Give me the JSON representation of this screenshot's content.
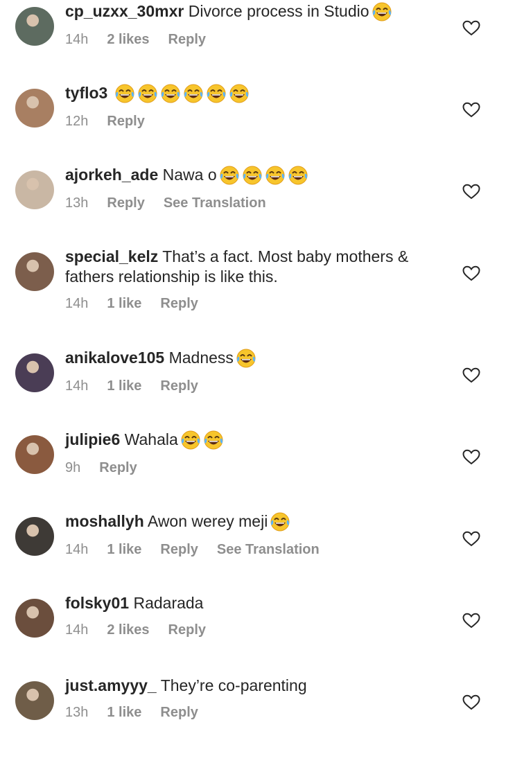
{
  "comments": [
    {
      "username": "cp_uzxx_30mxr",
      "text": "Divorce process in Studio",
      "emojis": [
        "laughing-tears-emoji"
      ],
      "time": "14h",
      "likes": "2 likes",
      "reply": "Reply",
      "translate": "",
      "avatar_color": "#5d6b60"
    },
    {
      "username": "tyflo3",
      "text": "",
      "emojis": [
        "laughing-tears-emoji",
        "laughing-tears-emoji",
        "laughing-tears-emoji",
        "laughing-tears-emoji",
        "laughing-tears-emoji",
        "laughing-tears-emoji"
      ],
      "time": "12h",
      "likes": "",
      "reply": "Reply",
      "translate": "",
      "avatar_color": "#a87f62"
    },
    {
      "username": "ajorkeh_ade",
      "text": "Nawa o",
      "emojis": [
        "laughing-tears-emoji",
        "laughing-tears-emoji",
        "laughing-tears-emoji",
        "laughing-tears-emoji"
      ],
      "time": "13h",
      "likes": "",
      "reply": "Reply",
      "translate": "See Translation",
      "avatar_color": "#c9b7a4"
    },
    {
      "username": "special_kelz",
      "text": "That’s a fact. Most baby mothers & fathers relationship is like this.",
      "emojis": [],
      "time": "14h",
      "likes": "1 like",
      "reply": "Reply",
      "translate": "",
      "avatar_color": "#7c5e4c"
    },
    {
      "username": "anikalove105",
      "text": "Madness",
      "emojis": [
        "laughing-tears-emoji"
      ],
      "time": "14h",
      "likes": "1 like",
      "reply": "Reply",
      "translate": "",
      "avatar_color": "#4a3d55"
    },
    {
      "username": "julipie6",
      "text": "Wahala",
      "emojis": [
        "laughing-tears-emoji",
        "laughing-tears-emoji"
      ],
      "time": "9h",
      "likes": "",
      "reply": "Reply",
      "translate": "",
      "avatar_color": "#8a5a3f"
    },
    {
      "username": "moshallyh",
      "text": "Awon werey meji",
      "emojis": [
        "laughing-tears-emoji"
      ],
      "time": "14h",
      "likes": "1 like",
      "reply": "Reply",
      "translate": "See Translation",
      "avatar_color": "#3e3a36"
    },
    {
      "username": "folsky01",
      "text": "Radarada",
      "emojis": [],
      "time": "14h",
      "likes": "2 likes",
      "reply": "Reply",
      "translate": "",
      "avatar_color": "#6b4e3d"
    },
    {
      "username": "just.amyyy_",
      "text": "They’re co-parenting",
      "emojis": [],
      "time": "13h",
      "likes": "1 like",
      "reply": "Reply",
      "translate": "",
      "avatar_color": "#6f5d48"
    }
  ]
}
